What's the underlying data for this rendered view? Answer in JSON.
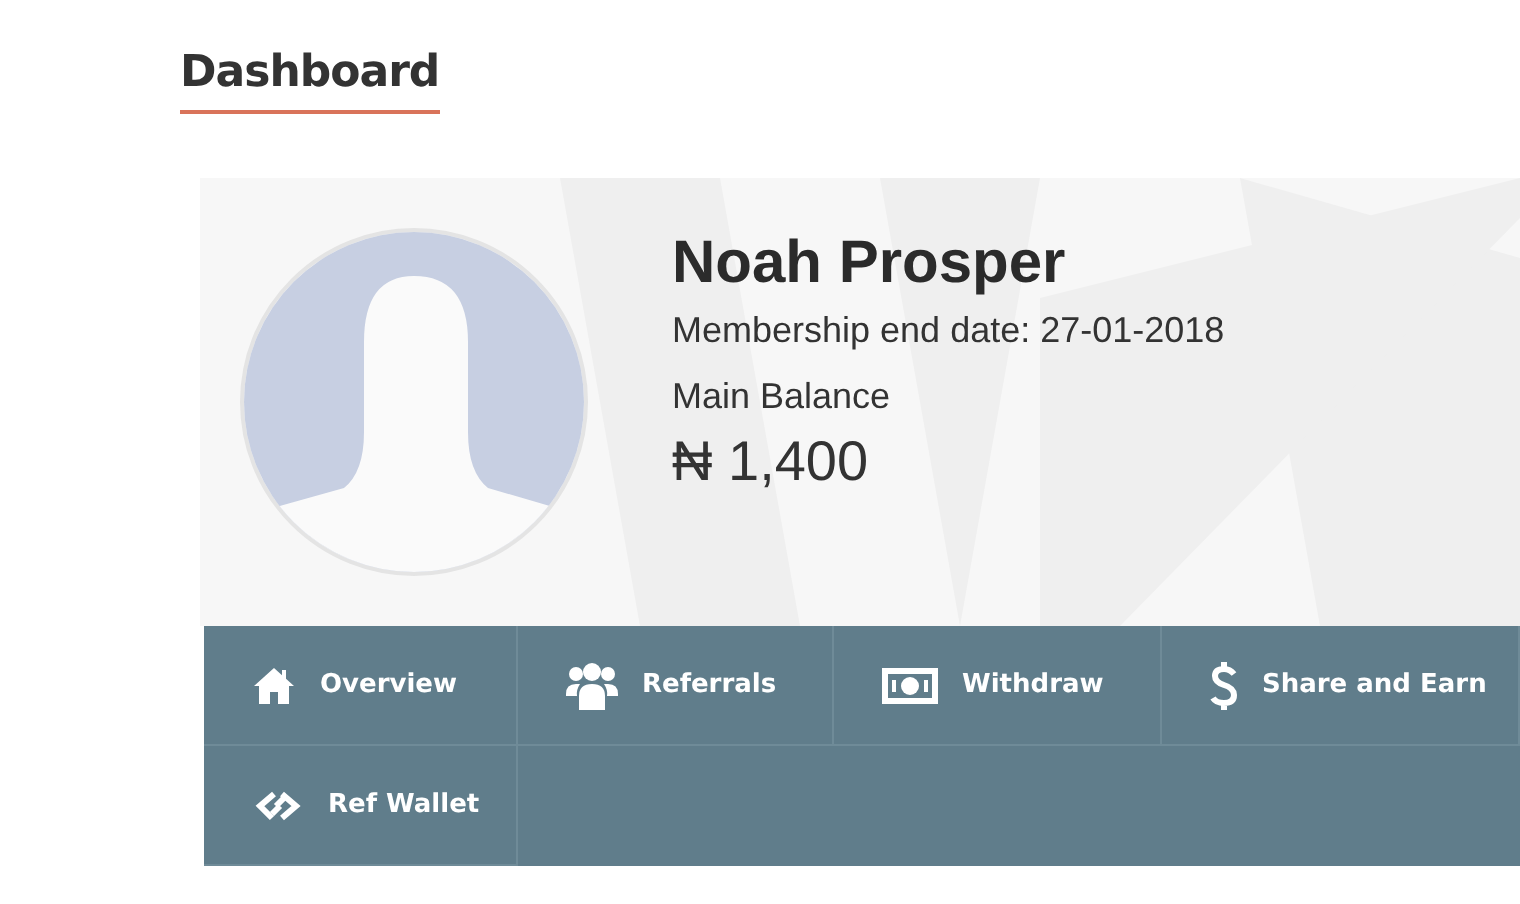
{
  "page": {
    "title": "Dashboard"
  },
  "profile": {
    "name": "Noah Prosper",
    "membership": "Membership end date: 27-01-2018",
    "balance_label": "Main Balance",
    "balance": "₦ 1,400"
  },
  "nav": [
    {
      "label": "Overview"
    },
    {
      "label": "Referrals"
    },
    {
      "label": "Withdraw"
    },
    {
      "label": "Share and Earn"
    },
    {
      "label": "Ref Wallet"
    }
  ]
}
